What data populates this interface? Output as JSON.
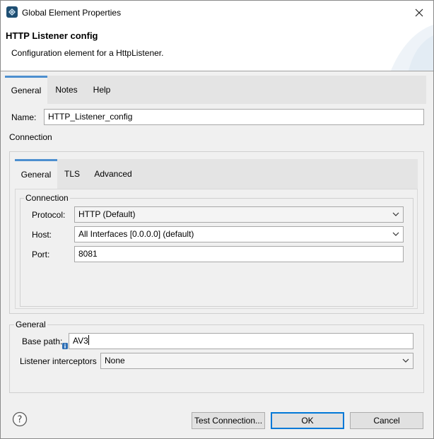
{
  "window": {
    "title": "Global Element Properties"
  },
  "header": {
    "title": "HTTP Listener config",
    "description": "Configuration element for a HttpListener."
  },
  "outer_tabs": [
    {
      "label": "General",
      "active": true
    },
    {
      "label": "Notes",
      "active": false
    },
    {
      "label": "Help",
      "active": false
    }
  ],
  "name_field": {
    "label": "Name:",
    "value": "HTTP_Listener_config"
  },
  "connection_section_label": "Connection",
  "inner_tabs": [
    {
      "label": "General",
      "active": true
    },
    {
      "label": "TLS",
      "active": false
    },
    {
      "label": "Advanced",
      "active": false
    }
  ],
  "connection_group": {
    "legend": "Connection",
    "protocol": {
      "label": "Protocol:",
      "value": "HTTP (Default)"
    },
    "host": {
      "label": "Host:",
      "value": "All Interfaces [0.0.0.0] (default)"
    },
    "port": {
      "label": "Port:",
      "value": "8081"
    }
  },
  "general_group": {
    "legend": "General",
    "base_path": {
      "label": "Base path:",
      "value": "AV3"
    },
    "listener_interceptors": {
      "label": "Listener interceptors",
      "value": "None"
    }
  },
  "buttons": {
    "test_connection": "Test Connection...",
    "ok": "OK",
    "cancel": "Cancel"
  },
  "icons": {
    "app": "mule-app-icon",
    "close": "close-icon",
    "help": "help-icon",
    "info": "info-icon",
    "dropdown": "chevron-down-icon"
  },
  "colors": {
    "active_tab_accent": "#4d8fcf",
    "default_button_border": "#0078d7",
    "app_icon": "#1f4f73"
  }
}
